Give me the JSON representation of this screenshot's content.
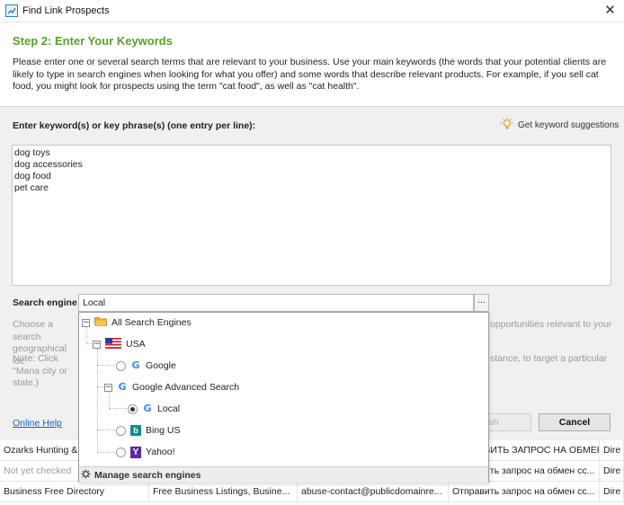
{
  "window": {
    "title": "Find Link Prospects",
    "close_glyph": "✕"
  },
  "header": {
    "step_title": "Step 2: Enter Your Keywords",
    "description": "Please enter one or several search terms that are relevant to your business. Use your main keywords (the words that your potential clients are likely to type in search engines when looking for what you offer) and some words that describe relevant products. For example, if you sell cat food, you might look for prospects using the term \"cat food\", as well as \"cat health\"."
  },
  "keywords": {
    "label": "Enter keyword(s) or key phrase(s) (one entry per line):",
    "suggest_label": "Get keyword suggestions",
    "suggest_icon": "lightbulb-icon",
    "lines": [
      "dog toys",
      "dog accessories",
      "dog food",
      "pet care"
    ]
  },
  "search_engine": {
    "label": "Search engine",
    "selected": "Local",
    "browse_label": "...",
    "choose_left": "Choose a search geographical loc",
    "choose_right": "opportunities relevant to your",
    "note_left": "Note: Click \"Mana city or state.)",
    "note_right": "stance, to target a particular"
  },
  "dropdown": {
    "root": {
      "label": "All Search Engines",
      "expander": "−",
      "icon": "folder-icon"
    },
    "country": {
      "label": "USA",
      "expander": "−",
      "icon": "us-flag-icon"
    },
    "google": {
      "label": "Google",
      "icon": "google-icon",
      "selected": false
    },
    "google_advanced": {
      "label": "Google Advanced Search",
      "expander": "−",
      "icon": "google-icon"
    },
    "local": {
      "label": "Local",
      "icon": "google-icon",
      "selected": true
    },
    "bing": {
      "label": "Bing US",
      "icon": "bing-icon",
      "selected": false
    },
    "yahoo": {
      "label": "Yahoo!",
      "icon": "yahoo-icon",
      "selected": false
    },
    "manage_label": "Manage search engines",
    "manage_icon": "gear-icon",
    "g_glyph": "G",
    "b_glyph": "b",
    "y_glyph": "Y"
  },
  "footer": {
    "online_help": "Online Help",
    "finish_label": "nish",
    "cancel_label": "Cancel"
  },
  "table": {
    "rows": [
      [
        "Ozarks Hunting & F",
        "",
        "",
        "ОТПРАВИТЬ ЗАПРОС НА ОБМЕН СС...",
        "Dire"
      ],
      [
        "Not yet checked",
        "",
        "",
        "Отправить запрос на обмен сс...",
        "Dire"
      ],
      [
        "Business Free Directory",
        "Free Business Listings, Busine...",
        "abuse-contact@publicdomainre...",
        "Отправить запрос на обмен сс...",
        "Dire"
      ]
    ]
  },
  "colors": {
    "accent_green": "#5aa02c",
    "link_blue": "#1a5fb4",
    "panel_gray": "#f0f0f0"
  }
}
